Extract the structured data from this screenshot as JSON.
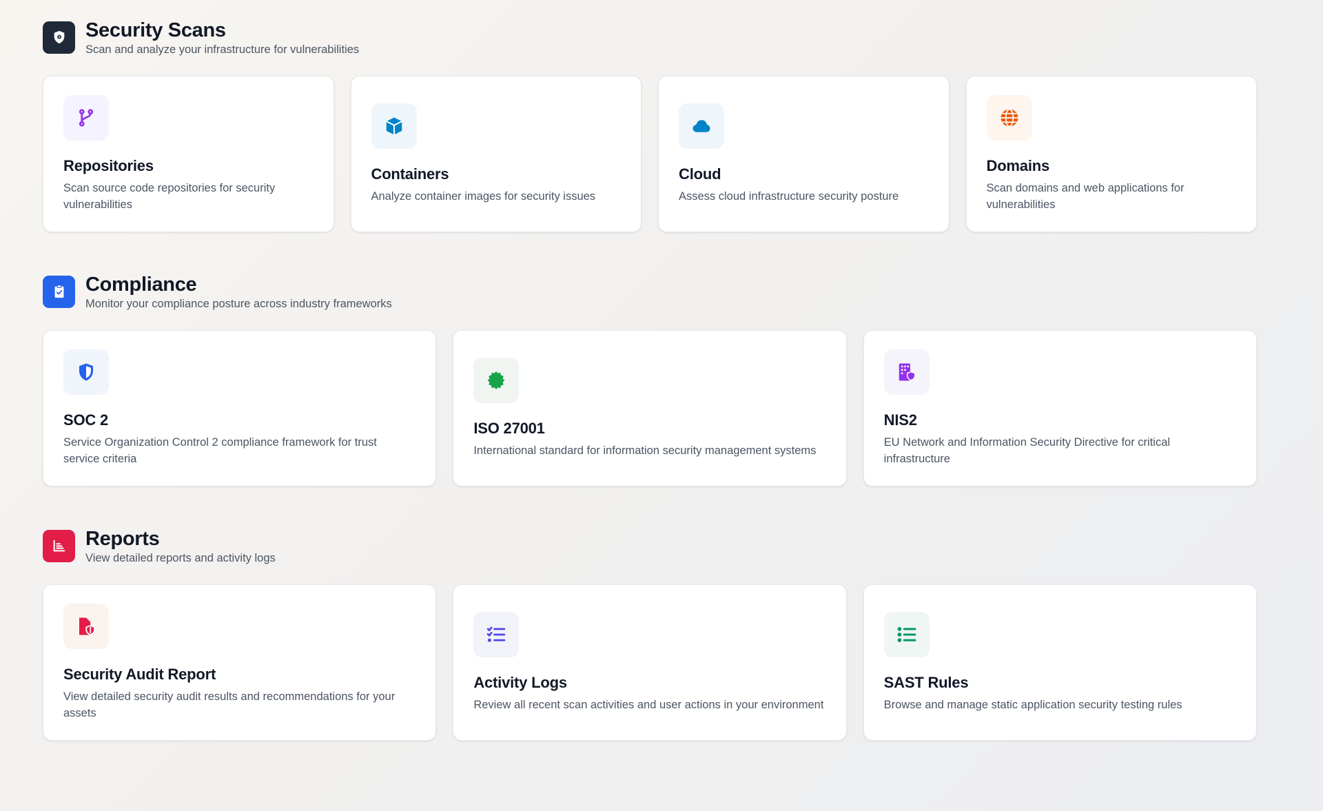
{
  "sections": [
    {
      "title": "Security Scans",
      "subtitle": "Scan and analyze your infrastructure for vulnerabilities",
      "icon": "shield-gear-icon",
      "icon_bg": "#1f2937",
      "cards": [
        {
          "title": "Repositories",
          "desc": "Scan source code repositories for security vulnerabilities",
          "icon": "git-branch-icon",
          "icon_color": "#9333ea",
          "icon_bg": "#f5f3ff"
        },
        {
          "title": "Containers",
          "desc": "Analyze container images for security issues",
          "icon": "cube-icon",
          "icon_color": "#0284c7",
          "icon_bg": "#eff6fb"
        },
        {
          "title": "Cloud",
          "desc": "Assess cloud infrastructure security posture",
          "icon": "cloud-icon",
          "icon_color": "#0284c7",
          "icon_bg": "#eff6fb"
        },
        {
          "title": "Domains",
          "desc": "Scan domains and web applications for vulnerabilities",
          "icon": "globe-icon",
          "icon_color": "#ea580c",
          "icon_bg": "#fdf5ee"
        }
      ]
    },
    {
      "title": "Compliance",
      "subtitle": "Monitor your compliance posture across industry frameworks",
      "icon": "clipboard-check-icon",
      "icon_bg": "#2563eb",
      "cards": [
        {
          "title": "SOC 2",
          "desc": "Service Organization Control 2 compliance framework for trust service criteria",
          "icon": "shield-half-icon",
          "icon_color": "#2563eb",
          "icon_bg": "#f0f4fb"
        },
        {
          "title": "ISO 27001",
          "desc": "International standard for information security management systems",
          "icon": "certificate-icon",
          "icon_color": "#16a34a",
          "icon_bg": "#f0f5f2"
        },
        {
          "title": "NIS2",
          "desc": "EU Network and Information Security Directive for critical infrastructure",
          "icon": "building-shield-icon",
          "icon_color": "#9333ea",
          "icon_bg": "#f5f3fb"
        }
      ]
    },
    {
      "title": "Reports",
      "subtitle": "View detailed reports and activity logs",
      "icon": "report-chart-icon",
      "icon_bg": "#e11d48",
      "cards": [
        {
          "title": "Security Audit Report",
          "desc": "View detailed security audit results and recommendations for your assets",
          "icon": "file-shield-icon",
          "icon_color": "#e11d48",
          "icon_bg": "#fbf3ee"
        },
        {
          "title": "Activity Logs",
          "desc": "Review all recent scan activities and user actions in your environment",
          "icon": "list-check-icon",
          "icon_color": "#4f46e5",
          "icon_bg": "#f1f3f9"
        },
        {
          "title": "SAST Rules",
          "desc": "Browse and manage static application security testing rules",
          "icon": "list-icon",
          "icon_color": "#059669",
          "icon_bg": "#eff6f4"
        }
      ]
    }
  ]
}
